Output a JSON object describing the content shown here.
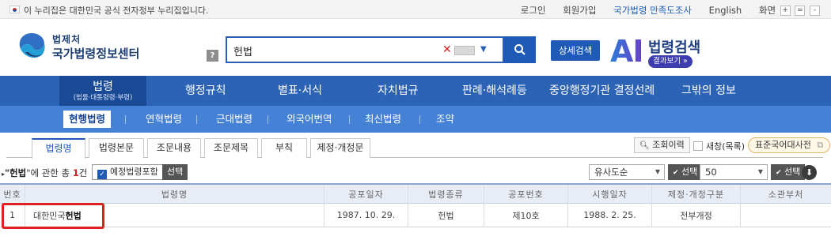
{
  "topbar": {
    "notice": "이 누리집은 대한민국 공식 전자정부 누리집입니다.",
    "links": [
      "로그인",
      "회원가입",
      "국가법령 만족도조사",
      "English",
      "화면"
    ],
    "zoom": [
      "+",
      "=",
      "-"
    ]
  },
  "logo": {
    "line1": "법제처",
    "line2": "국가법령정보센터"
  },
  "search": {
    "help": "?",
    "query": "헌법",
    "clear": "✕",
    "dropdown": "▼",
    "detail_label": "상세검색"
  },
  "ai": {
    "letters": "AI",
    "title": "법령검색",
    "sub": "결과보기 »"
  },
  "mainnav": {
    "active": {
      "label": "법령",
      "sub": "(법률·대통령령·부령)"
    },
    "items": [
      "행정규칙",
      "별표·서식",
      "자치법규",
      "판례·해석례등",
      "중앙행정기관 결정선례",
      "그밖의 정보"
    ]
  },
  "subnav": {
    "items": [
      "현행법령",
      "연혁법령",
      "근대법령",
      "외국어번역",
      "최신법령",
      "조약"
    ]
  },
  "tabs": [
    "법령명",
    "법령본문",
    "조문내용",
    "조문제목",
    "부칙",
    "제정·개정문"
  ],
  "tools": {
    "history": "조회이력",
    "new_window": "새창(목록)",
    "dictionary": "표준국어대사전"
  },
  "results": {
    "prefix": "\"",
    "keyword": "헌법",
    "middle": "\"에 관한  총 ",
    "count": "1",
    "suffix": "건",
    "include_scheduled": "예정법령포함",
    "select": "선택",
    "sort": "유사도순",
    "page_size": "50"
  },
  "table": {
    "headers": [
      "번호",
      "법령명",
      "공포일자",
      "법령종류",
      "공포번호",
      "시행일자",
      "제정·개정구분",
      "소관부처"
    ],
    "rows": [
      {
        "no": "1",
        "name_prefix": "대한민국",
        "name_keyword": "헌법",
        "promulgation_date": "1987. 10. 29.",
        "type": "헌법",
        "promulgation_no": "제10호",
        "effective_date": "1988. 2. 25.",
        "revision": "전부개정",
        "ministry": ""
      }
    ]
  },
  "colors": {
    "nav": "#2c63b5",
    "subnav": "#4582d6",
    "accent": "#1f5bb6",
    "highlight": "#e01f1f"
  }
}
